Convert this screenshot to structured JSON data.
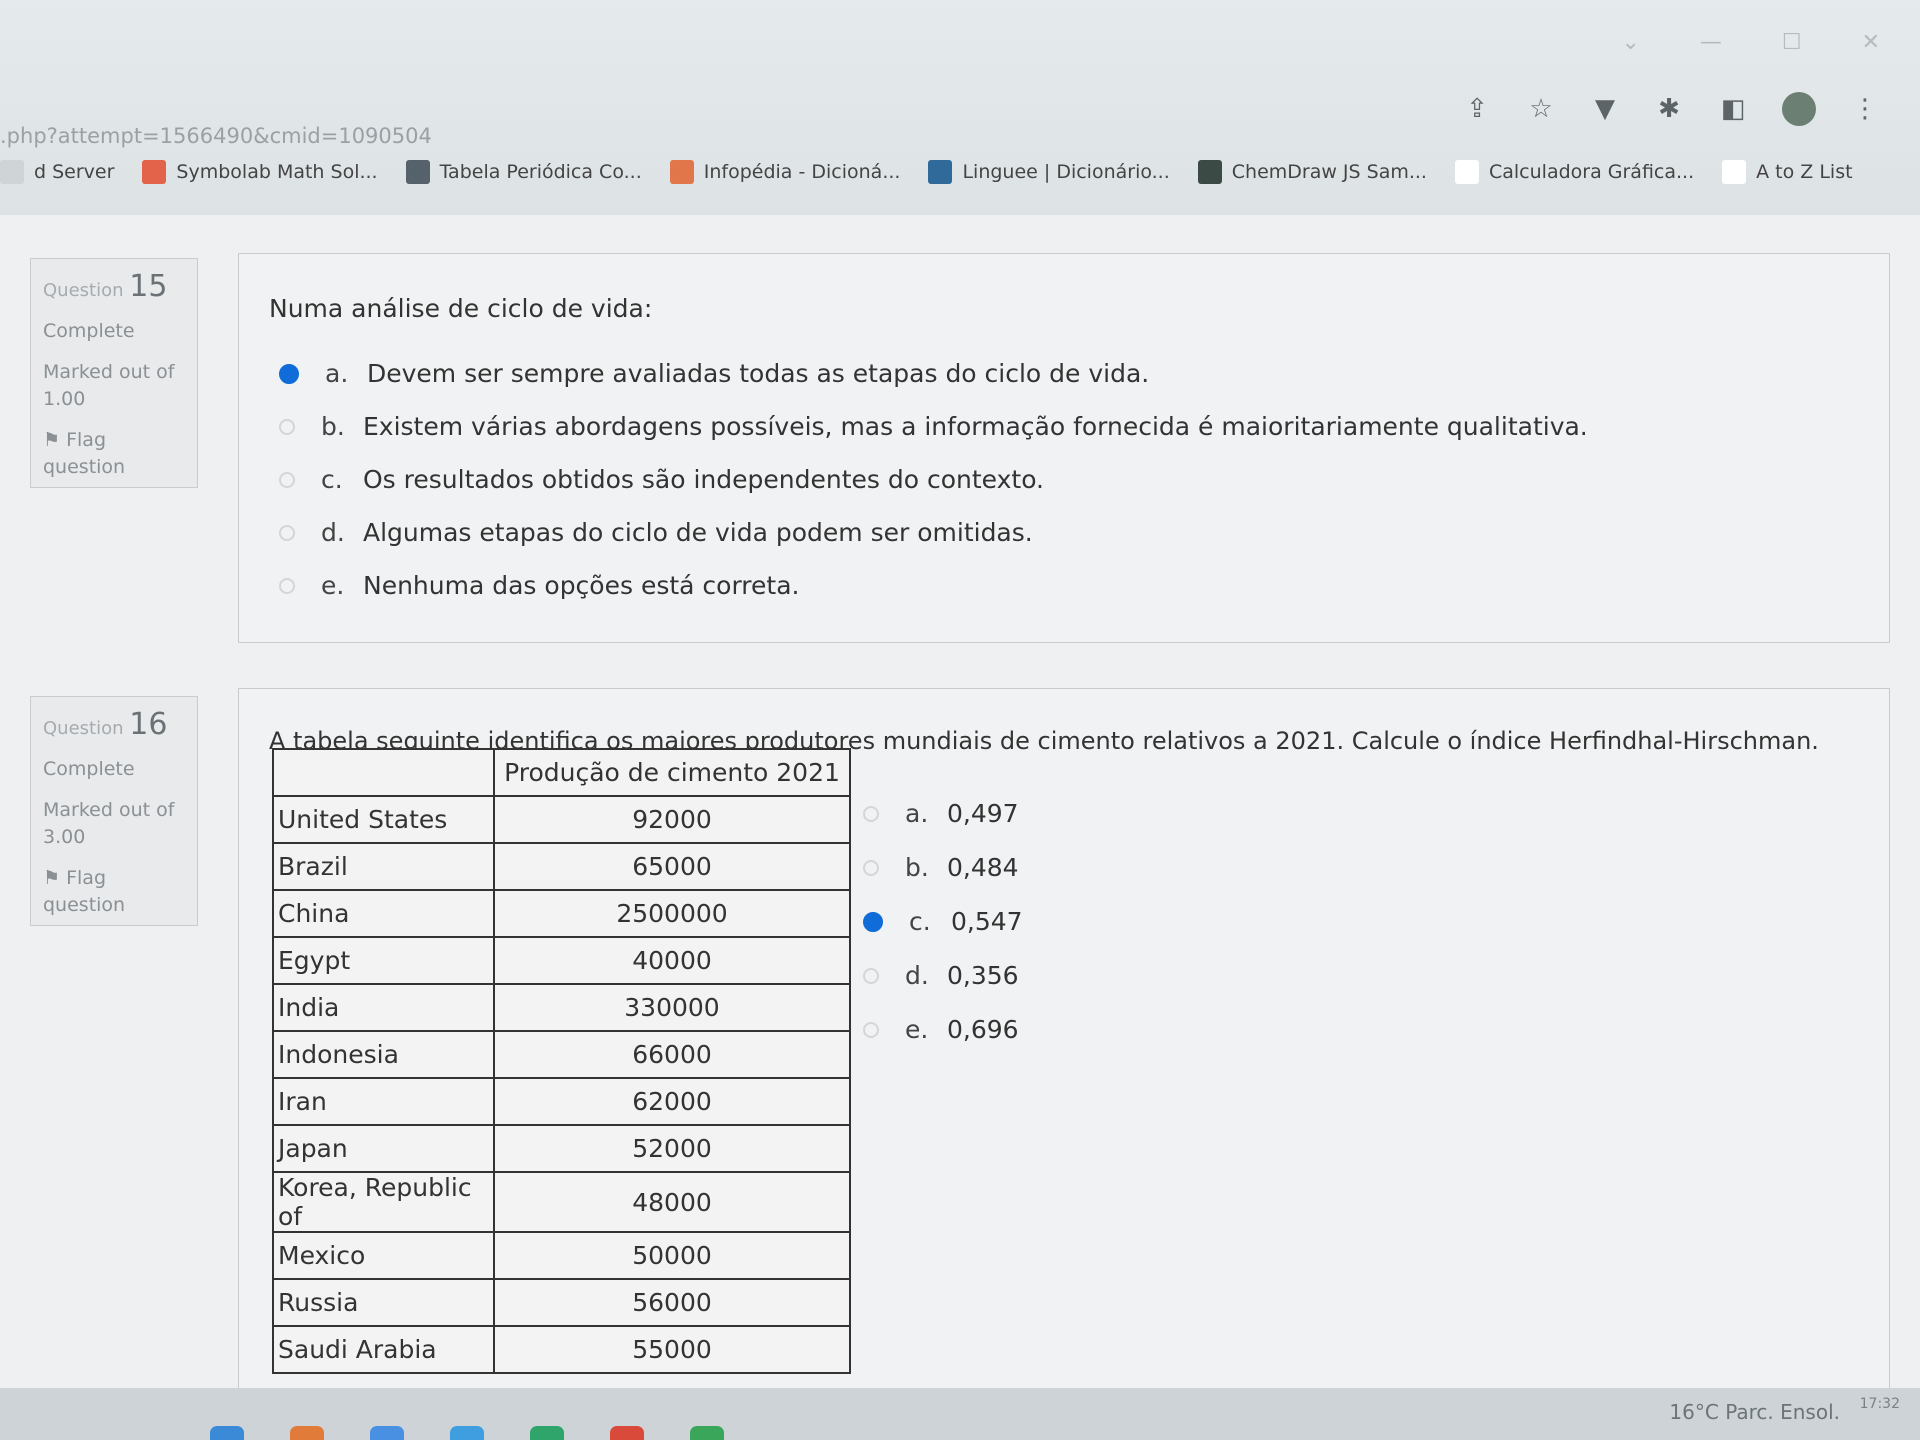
{
  "browser": {
    "url": ".php?attempt=1566490&cmid=1090504",
    "bookmarks": [
      {
        "label": "d Server",
        "icon": "server-icon",
        "color": "#cfd4d6"
      },
      {
        "label": "Symbolab Math Sol...",
        "icon": "symbolab-icon",
        "color": "#e2624a"
      },
      {
        "label": "Tabela Periódica Co...",
        "icon": "periodic-table-icon",
        "color": "#55626b"
      },
      {
        "label": "Infopédia - Dicioná...",
        "icon": "infopedia-icon",
        "color": "#e0764a"
      },
      {
        "label": "Linguee | Dicionário...",
        "icon": "linguee-icon",
        "color": "#2f6a9a"
      },
      {
        "label": "ChemDraw JS Sam...",
        "icon": "chemdraw-icon",
        "color": "#3b4a44"
      },
      {
        "label": "Calculadora Gráfica...",
        "icon": "graph-calculator-icon",
        "color": "#ffffff"
      },
      {
        "label": "A to Z List",
        "icon": "a-to-z-icon",
        "color": "#ffffff"
      }
    ]
  },
  "q15": {
    "info": {
      "prefix": "Question",
      "number": "15",
      "status": "Complete",
      "marked": "Marked out of",
      "marks": "1.00",
      "flag": "Flag question"
    },
    "text": "Numa análise de ciclo de vida:",
    "options": [
      {
        "letter": "a.",
        "text": "Devem ser sempre avaliadas todas as etapas do ciclo de vida.",
        "selected": true
      },
      {
        "letter": "b.",
        "text": "Existem várias abordagens possíveis, mas a informação fornecida é maioritariamente qualitativa.",
        "selected": false
      },
      {
        "letter": "c.",
        "text": "Os resultados obtidos são independentes do contexto.",
        "selected": false
      },
      {
        "letter": "d.",
        "text": "Algumas etapas do ciclo de vida podem ser omitidas.",
        "selected": false
      },
      {
        "letter": "e.",
        "text": "Nenhuma das opções está correta.",
        "selected": false
      }
    ]
  },
  "q16": {
    "info": {
      "prefix": "Question",
      "number": "16",
      "status": "Complete",
      "marked": "Marked out of",
      "marks": "3.00",
      "flag": "Flag question"
    },
    "text": "A tabela seguinte identifica os maiores produtores mundiais de cimento relativos a 2021. Calcule o índice Herfindhal-Hirschman.",
    "table_header": "Produção de cimento 2021",
    "rows": [
      {
        "country": "United States",
        "value": "92000"
      },
      {
        "country": "Brazil",
        "value": "65000"
      },
      {
        "country": "China",
        "value": "2500000"
      },
      {
        "country": "Egypt",
        "value": "40000"
      },
      {
        "country": "India",
        "value": "330000"
      },
      {
        "country": "Indonesia",
        "value": "66000"
      },
      {
        "country": "Iran",
        "value": "62000"
      },
      {
        "country": "Japan",
        "value": "52000"
      },
      {
        "country": "Korea, Republic of",
        "value": "48000"
      },
      {
        "country": "Mexico",
        "value": "50000"
      },
      {
        "country": "Russia",
        "value": "56000"
      },
      {
        "country": "Saudi Arabia",
        "value": "55000"
      }
    ],
    "options": [
      {
        "letter": "a.",
        "text": "0,497",
        "selected": false
      },
      {
        "letter": "b.",
        "text": "0,484",
        "selected": false
      },
      {
        "letter": "c.",
        "text": "0,547",
        "selected": true
      },
      {
        "letter": "d.",
        "text": "0,356",
        "selected": false
      },
      {
        "letter": "e.",
        "text": "0,696",
        "selected": false
      }
    ]
  },
  "taskbar": {
    "weather": "16°C  Parc. Ensol.",
    "time": "17:32"
  },
  "colors": {
    "accent": "#0f6cd8"
  }
}
